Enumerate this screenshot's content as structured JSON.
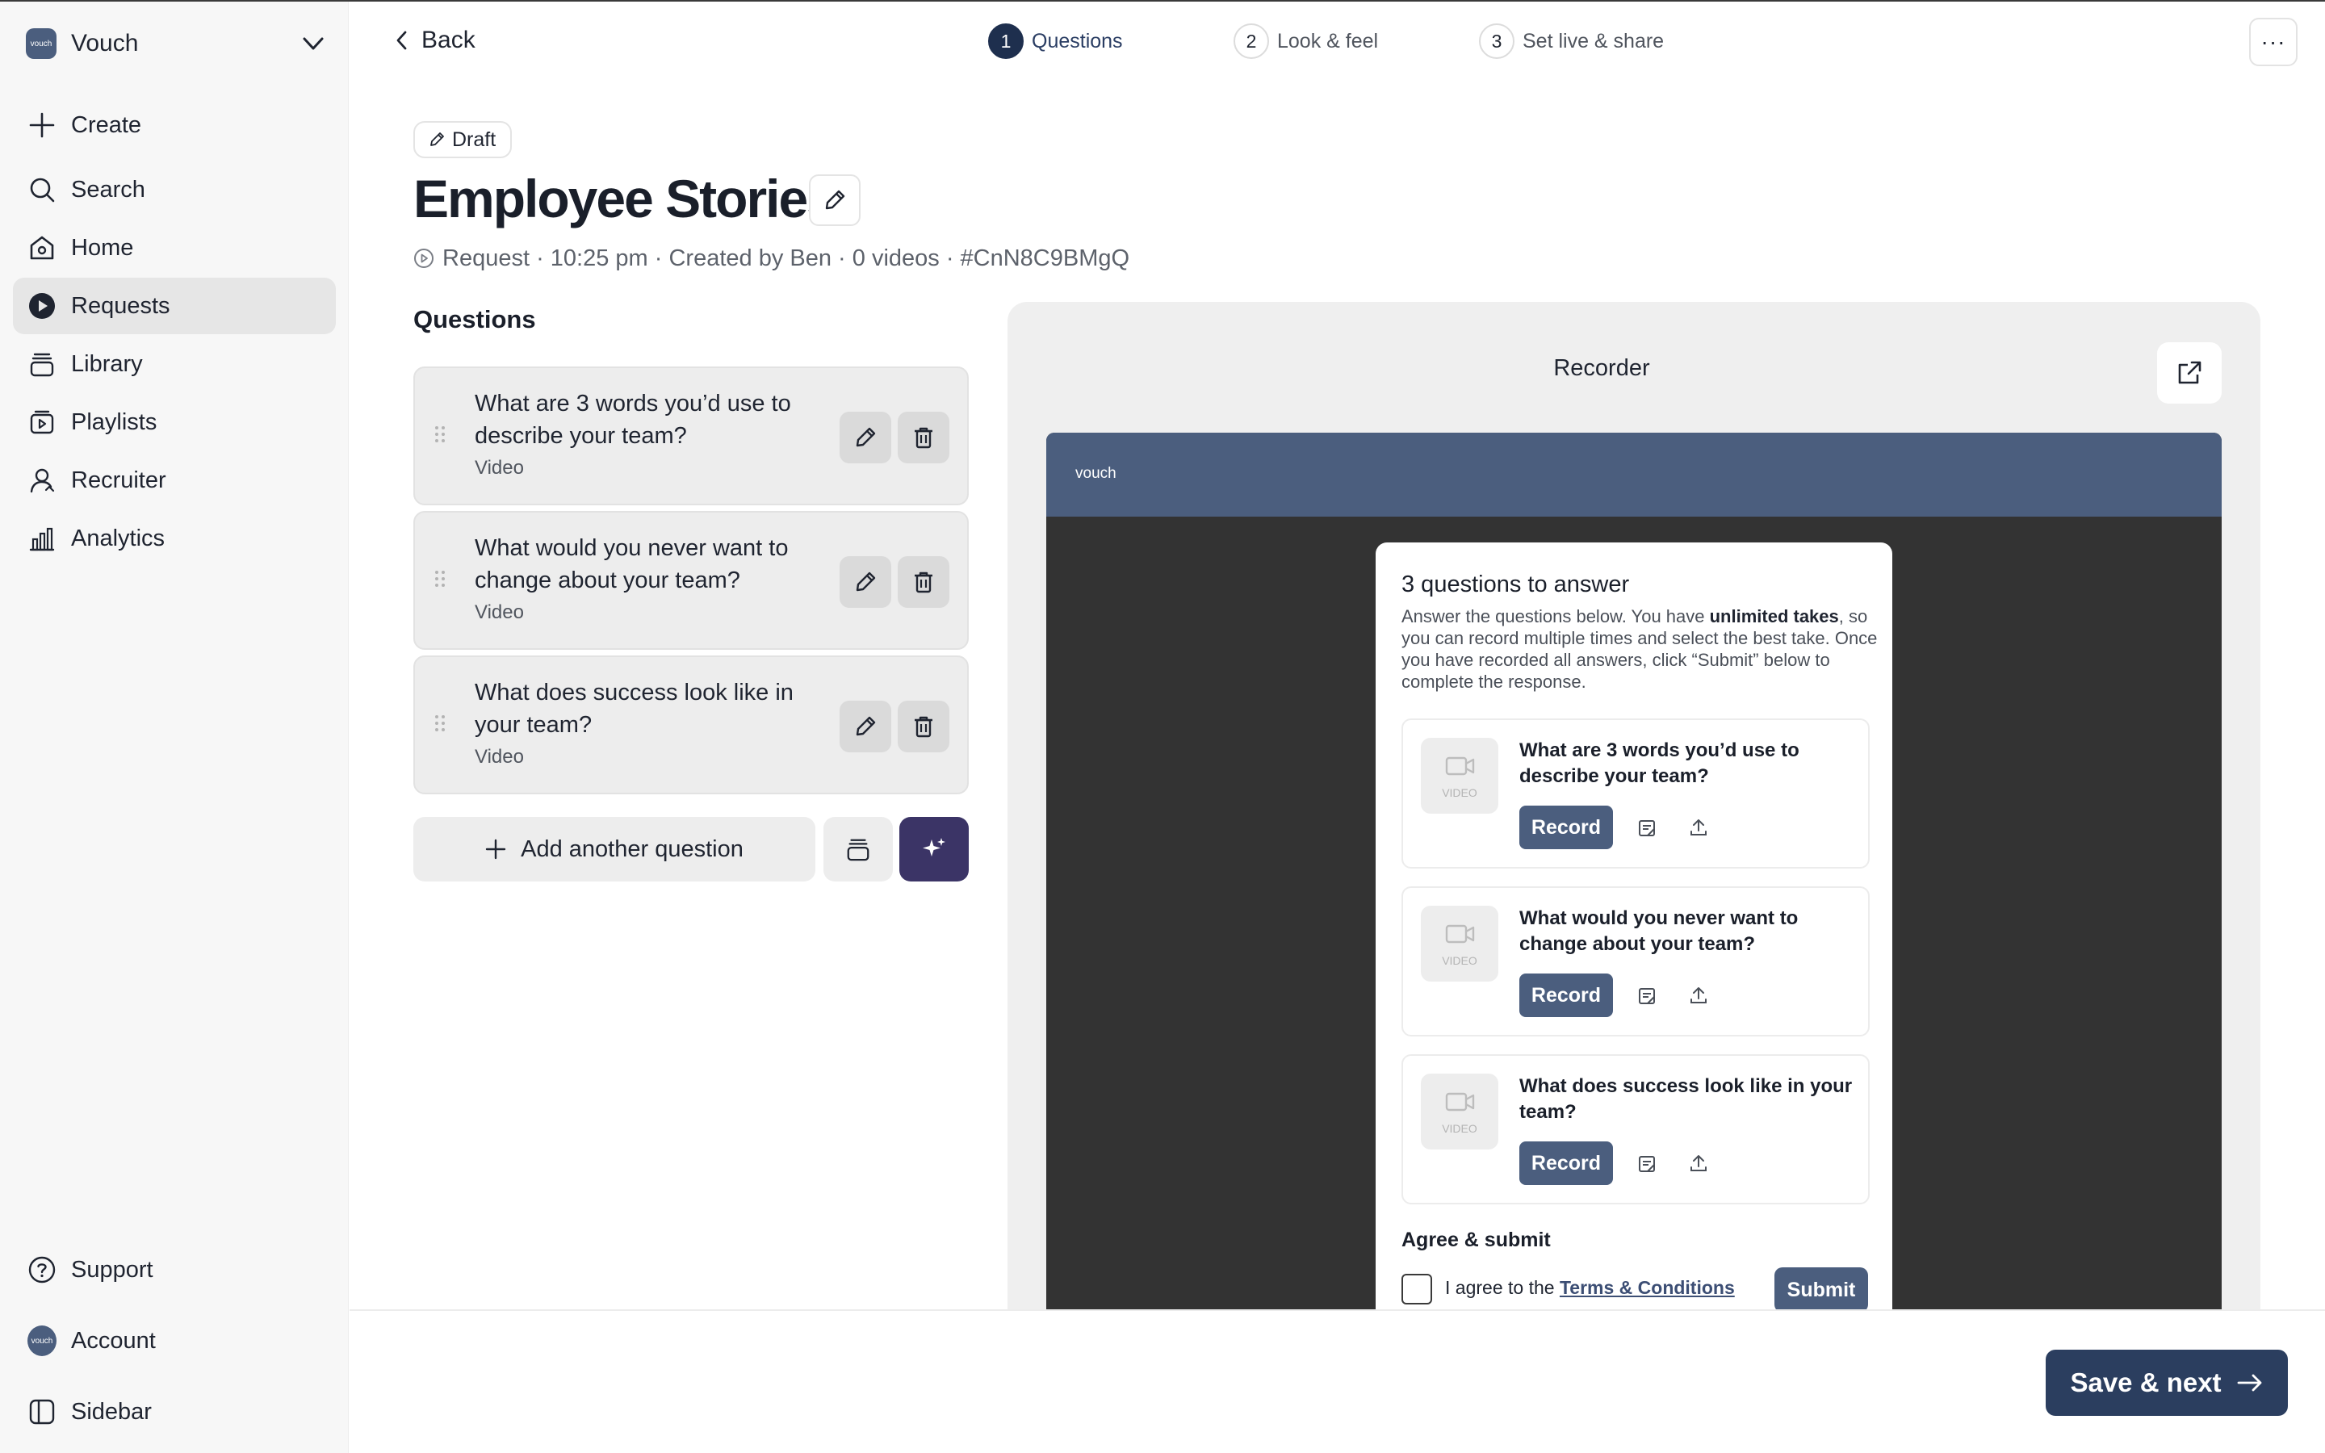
{
  "brand": {
    "logo_text": "vouch",
    "name": "Vouch"
  },
  "sidebar": {
    "items": [
      {
        "label": "Create",
        "icon": "plus-icon"
      },
      {
        "label": "Search",
        "icon": "search-icon"
      },
      {
        "label": "Home",
        "icon": "home-icon"
      },
      {
        "label": "Requests",
        "icon": "requests-icon",
        "active": true
      },
      {
        "label": "Library",
        "icon": "library-icon"
      },
      {
        "label": "Playlists",
        "icon": "playlists-icon"
      },
      {
        "label": "Recruiter",
        "icon": "recruiter-icon"
      },
      {
        "label": "Analytics",
        "icon": "analytics-icon"
      }
    ],
    "bottom": [
      {
        "label": "Support",
        "icon": "help-icon"
      },
      {
        "label": "Account",
        "icon": "avatar",
        "avatar_text": "vouch"
      },
      {
        "label": "Sidebar",
        "icon": "sidebar-toggle-icon"
      }
    ]
  },
  "topbar": {
    "back_label": "Back",
    "steps": [
      {
        "num": "1",
        "label": "Questions",
        "active": true
      },
      {
        "num": "2",
        "label": "Look & feel"
      },
      {
        "num": "3",
        "label": "Set live & share"
      }
    ],
    "more_label": "···"
  },
  "header": {
    "badge": "Draft",
    "title": "Employee Stories",
    "meta": "Request · 10:25 pm · Created by Ben · 0 videos · #CnN8C9BMgQ"
  },
  "questions": {
    "heading": "Questions",
    "items": [
      {
        "text": "What are 3 words you’d use to describe your team?",
        "type": "Video"
      },
      {
        "text": "What would you never want to change about your team?",
        "type": "Video"
      },
      {
        "text": "What does success look like in your team?",
        "type": "Video"
      }
    ],
    "add_label": "Add another question"
  },
  "preview": {
    "title": "Recorder",
    "recorder": {
      "logo": "vouch",
      "title": "3 questions to answer",
      "desc_before": "Answer the questions below. You have ",
      "desc_bold": "unlimited takes",
      "desc_after": ", so you can record multiple times and select the best take. Once you have recorded all answers, click “Submit” below to complete the response.",
      "thumb_label": "VIDEO",
      "record_label": "Record",
      "questions": [
        "What are 3 words you’d use to describe your team?",
        "What would you never want to change about your team?",
        "What does success look like in your team?"
      ],
      "agree_title": "Agree & submit",
      "agree_text": "I agree to the ",
      "agree_link": "Terms & Conditions",
      "submit_label": "Submit"
    }
  },
  "footer": {
    "save_label": "Save & next"
  },
  "colors": {
    "brand": "#4b5e7e",
    "primary_dark": "#2b3e5f",
    "ai_button": "#3b3466",
    "active_nav": "#e6e6e6"
  }
}
